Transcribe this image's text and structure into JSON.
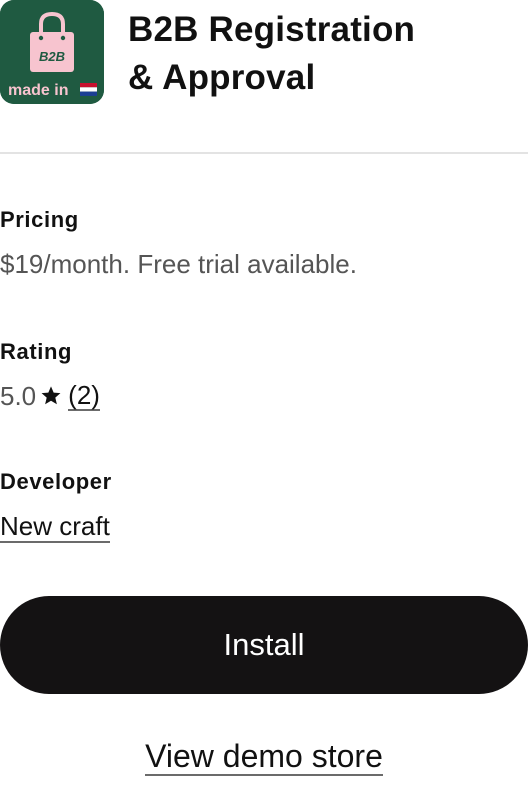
{
  "app": {
    "name": "B2B Registration & Approval",
    "name_line1": "B2B Registration",
    "name_line2": "& Approval",
    "icon": {
      "name": "shopping-bag-icon",
      "bag_text": "B2B",
      "badge_text": "made in",
      "flag": "dutch-flag-icon",
      "background": "#1f5a41",
      "bag_color": "#f7c4cf"
    }
  },
  "details": {
    "pricing": {
      "label": "Pricing",
      "value": "$19/month. Free trial available."
    },
    "rating": {
      "label": "Rating",
      "score": "5.0",
      "icon": "star-icon",
      "review_count": "(2)"
    },
    "developer": {
      "label": "Developer",
      "name": "New craft"
    }
  },
  "actions": {
    "install_label": "Install",
    "demo_label": "View demo store"
  },
  "colors": {
    "primary_button": "#141213",
    "text": "#111111",
    "muted_text": "#555555",
    "divider": "#e3e3e3"
  }
}
